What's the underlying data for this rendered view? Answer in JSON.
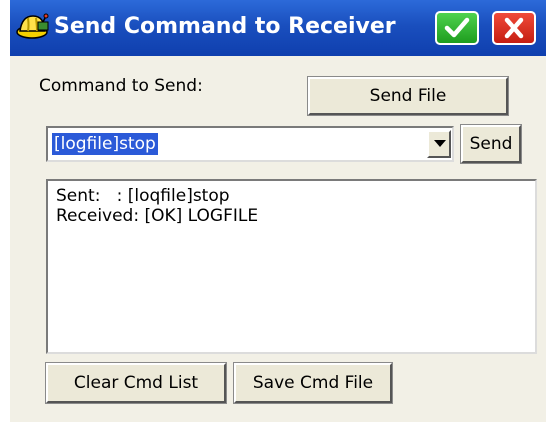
{
  "titlebar": {
    "title": "Send Command to Receiver",
    "app_icon": "hardhat-satellite-icon",
    "ok_icon": "checkmark-icon",
    "close_icon": "close-x-icon"
  },
  "form": {
    "command_label": "Command to Send:",
    "send_file_label": "Send File",
    "command_value": "[logfile]stop",
    "send_label": "Send"
  },
  "log": {
    "lines": [
      "Sent:   : [loqfile]stop",
      "Received: [OK] LOGFILE"
    ]
  },
  "footer": {
    "clear_label": "Clear Cmd List",
    "save_label": "Save Cmd File"
  },
  "colors": {
    "titlebar": "#1a4fbe",
    "ok_button": "#2fb52f",
    "close_button": "#d9261a",
    "selection": "#2b5ad8",
    "window_bg": "#f2f0e6"
  }
}
